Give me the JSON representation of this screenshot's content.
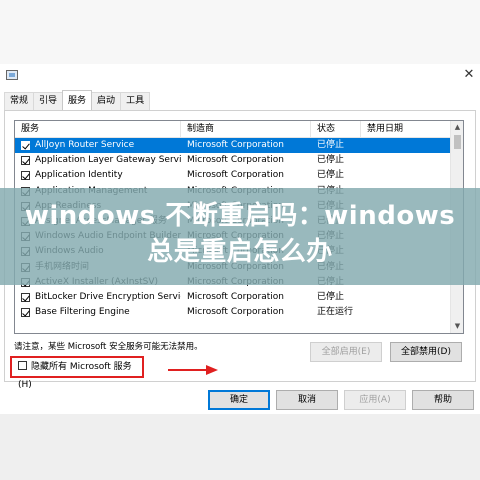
{
  "tabs": [
    "常规",
    "引导",
    "服务",
    "启动",
    "工具"
  ],
  "active_tab": 2,
  "columns": [
    "服务",
    "制造商",
    "状态",
    "禁用日期"
  ],
  "services": [
    {
      "name": "AllJoyn Router Service",
      "vendor": "Microsoft Corporation",
      "status": "已停止",
      "checked": true,
      "selected": true
    },
    {
      "name": "Application Layer Gateway Service",
      "vendor": "Microsoft Corporation",
      "status": "已停止",
      "checked": true,
      "selected": false
    },
    {
      "name": "Application Identity",
      "vendor": "Microsoft Corporation",
      "status": "已停止",
      "checked": true,
      "selected": false
    },
    {
      "name": "Application Management",
      "vendor": "Microsoft Corporation",
      "status": "已停止",
      "checked": true,
      "selected": false
    },
    {
      "name": "App Readiness",
      "vendor": "Microsoft Corporation",
      "status": "已停止",
      "checked": true,
      "selected": false
    },
    {
      "name": "AssignedAccessManager 服务",
      "vendor": "Microsoft Corporation",
      "status": "已停止",
      "checked": true,
      "selected": false
    },
    {
      "name": "Windows Audio Endpoint Builder",
      "vendor": "Microsoft Corporation",
      "status": "已停止",
      "checked": true,
      "selected": false
    },
    {
      "name": "Windows Audio",
      "vendor": "Microsoft Corporation",
      "status": "已停止",
      "checked": true,
      "selected": false
    },
    {
      "name": "手机网络时间",
      "vendor": "Microsoft Corporation",
      "status": "已停止",
      "checked": true,
      "selected": false
    },
    {
      "name": "ActiveX Installer (AxInstSV)",
      "vendor": "Microsoft Corporation",
      "status": "已停止",
      "checked": true,
      "selected": false
    },
    {
      "name": "BitLocker Drive Encryption Service",
      "vendor": "Microsoft Corporation",
      "status": "已停止",
      "checked": true,
      "selected": false
    },
    {
      "name": "Base Filtering Engine",
      "vendor": "Microsoft Corporation",
      "status": "正在运行",
      "checked": true,
      "selected": false
    }
  ],
  "note": "请注意，某些 Microsoft 安全服务可能无法禁用。",
  "buttons": {
    "enable_all": "全部启用(E)",
    "disable_all": "全部禁用(D)",
    "ok": "确定",
    "cancel": "取消",
    "apply": "应用(A)",
    "help": "帮助"
  },
  "hide_ms_label": "隐藏所有 Microsoft 服务(H)",
  "hide_ms_checked": false,
  "close_glyph": "✕",
  "banner_title": "windows 不断重启吗：windows总是重启怎么办",
  "colors": {
    "selection": "#0078d7",
    "highlight_box": "#e02020",
    "banner": "#82aaaf"
  }
}
